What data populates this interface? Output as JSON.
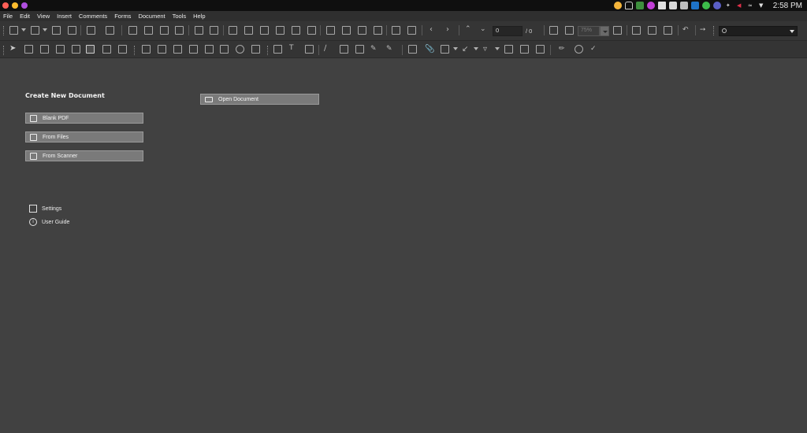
{
  "system_bar": {
    "traffic_lights": [
      "#ff5f57",
      "#febc2e",
      "#b04fe0"
    ],
    "tray_icons": [
      "emoji-icon",
      "bell-icon",
      "recycle-icon",
      "messenger-icon",
      "wing-icon",
      "drive-icon",
      "keyboard-icon",
      "outlook-icon",
      "check-icon",
      "teams-icon",
      "bluetooth-icon",
      "volume-icon",
      "wifi-icon",
      "menu-down-icon"
    ],
    "clock": "2:58 PM"
  },
  "menubar": {
    "items": [
      "File",
      "Edit",
      "View",
      "Insert",
      "Comments",
      "Forms",
      "Document",
      "Tools",
      "Help"
    ]
  },
  "toolbar": {
    "page_number": "0",
    "page_total": "/ 0",
    "zoom": "75%",
    "search_placeholder": ""
  },
  "main": {
    "create_title": "Create New Document",
    "blank_pdf": "Blank PDF",
    "from_files": "From Files",
    "from_scanner": "From Scanner",
    "open_document": "Open Document",
    "settings": "Settings",
    "user_guide": "User Guide"
  }
}
